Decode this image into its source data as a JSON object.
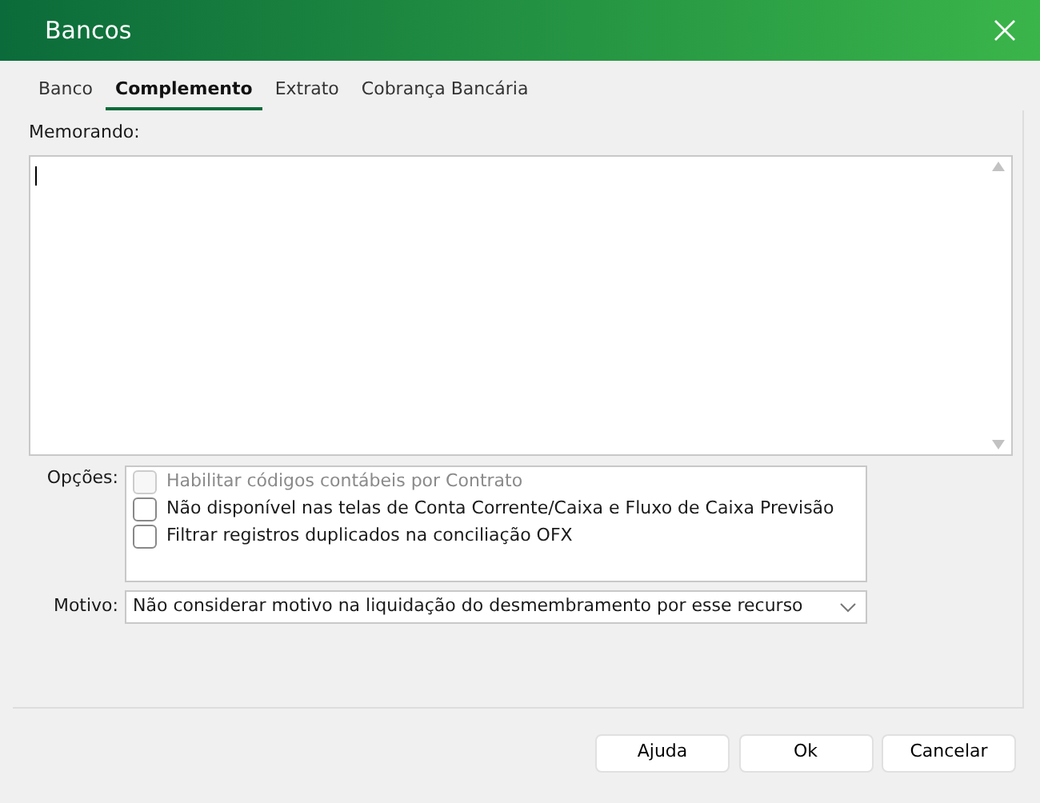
{
  "window": {
    "title": "Bancos"
  },
  "tabs": [
    {
      "label": "Banco",
      "selected": false
    },
    {
      "label": "Complemento",
      "selected": true
    },
    {
      "label": "Extrato",
      "selected": false
    },
    {
      "label": "Cobrança Bancária",
      "selected": false
    }
  ],
  "memo": {
    "label": "Memorando:"
  },
  "options": {
    "label": "Opções:",
    "items": [
      {
        "label": "Habilitar códigos contábeis por Contrato",
        "checked": false,
        "disabled": true
      },
      {
        "label": "Não disponível nas telas de Conta Corrente/Caixa e Fluxo de Caixa Previsão",
        "checked": false,
        "disabled": false
      },
      {
        "label": "Filtrar registros duplicados na conciliação OFX",
        "checked": false,
        "disabled": false
      }
    ]
  },
  "motivo": {
    "label": "Motivo:",
    "value": "Não considerar motivo na liquidação do desmembramento por esse recurso"
  },
  "buttons": [
    "Ajuda",
    "Ok",
    "Cancelar"
  ]
}
